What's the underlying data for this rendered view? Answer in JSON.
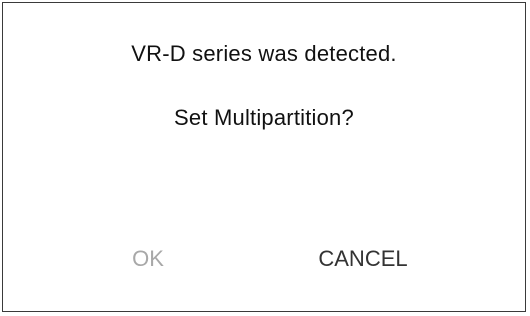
{
  "dialog": {
    "message": "VR-D series was detected.",
    "question": "Set Multipartition?",
    "ok_label": "OK",
    "cancel_label": "CANCEL",
    "ok_state": "disabled"
  }
}
